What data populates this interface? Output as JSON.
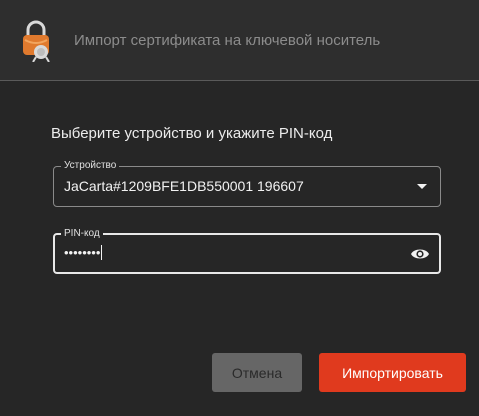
{
  "window": {
    "title": "Импорт сертификата на ключевой носитель",
    "icon": "certificate-lock-icon"
  },
  "form": {
    "instruction": "Выберите устройство и укажите PIN-код",
    "device": {
      "label": "Устройство",
      "value": "JaCarta#1209BFE1DB550001 196607",
      "icon": "chevron-down-icon"
    },
    "pin": {
      "label": "PIN-код",
      "value": "••••••••",
      "icon": "eye-icon"
    }
  },
  "buttons": {
    "cancel": "Отмена",
    "import": "Импортировать"
  },
  "colors": {
    "accent": "#e03a1e",
    "background": "#262626",
    "titlebar": "#2e2e2e"
  }
}
